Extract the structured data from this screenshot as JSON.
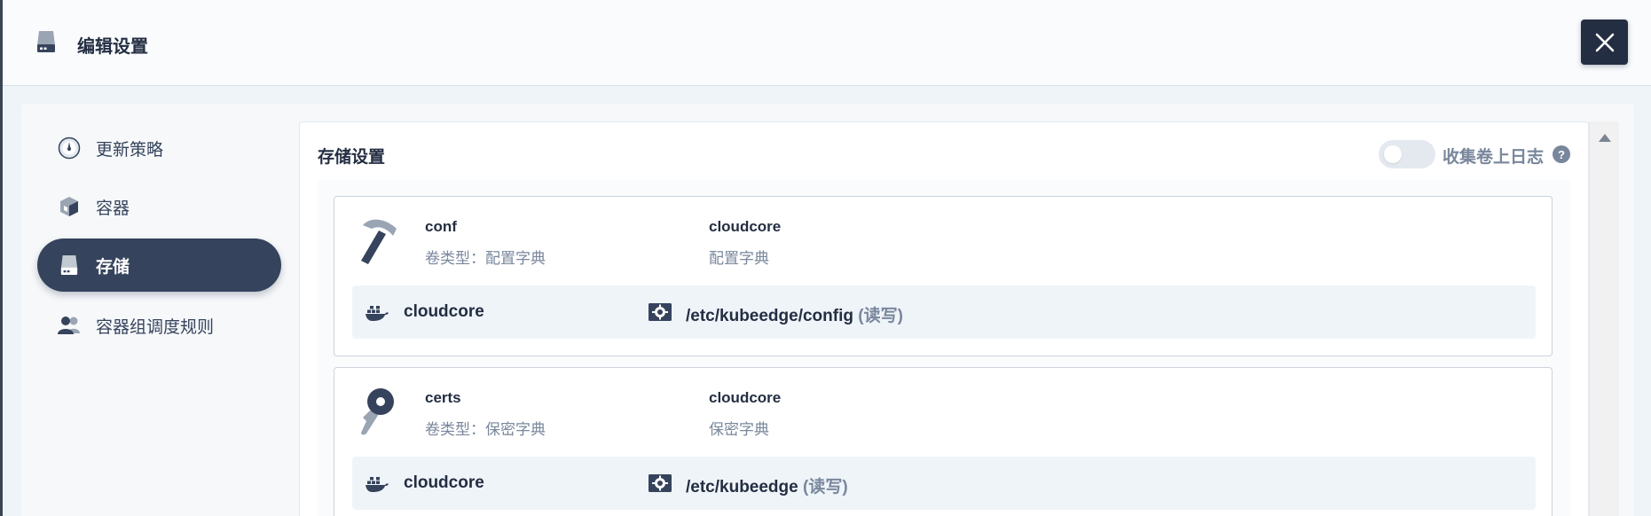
{
  "dialog": {
    "title": "编辑设置",
    "close_icon": "close-icon",
    "header_icon": "storage-icon"
  },
  "sidebar": {
    "items": [
      {
        "label": "更新策略",
        "icon": "update-strategy-icon",
        "active": false
      },
      {
        "label": "容器",
        "icon": "container-icon",
        "active": false
      },
      {
        "label": "存储",
        "icon": "storage-icon",
        "active": true
      },
      {
        "label": "容器组调度规则",
        "icon": "users-icon",
        "active": false
      }
    ]
  },
  "storage": {
    "title": "存储设置",
    "collect_logs_label": "收集卷上日志",
    "collect_logs_enabled": false,
    "help_icon": "help-icon",
    "volumes": [
      {
        "name": "conf",
        "type_label": "卷类型：配置字典",
        "source_name": "cloudcore",
        "source_type": "配置字典",
        "icon": "hammer-icon",
        "mount": {
          "container": "cloudcore",
          "path": "/etc/kubeedge/config",
          "mode": "(读写)"
        }
      },
      {
        "name": "certs",
        "type_label": "卷类型：保密字典",
        "source_name": "cloudcore",
        "source_type": "保密字典",
        "icon": "key-icon",
        "mount": {
          "container": "cloudcore",
          "path": "/etc/kubeedge",
          "mode": "(读写)"
        }
      }
    ]
  },
  "colors": {
    "primary_dark": "#242e42",
    "nav_active": "#36435c",
    "muted_text": "#79879c",
    "row_background": "#eff4f9"
  }
}
